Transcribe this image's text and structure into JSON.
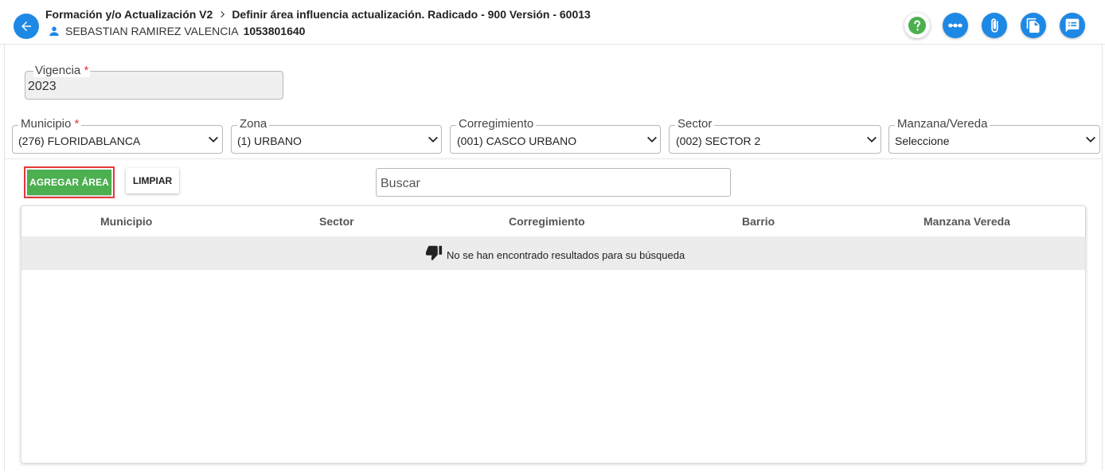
{
  "header": {
    "breadcrumb": [
      "Formación y/o Actualización V2",
      "Definir área influencia actualización. Radicado - 900 Versión - 60013"
    ],
    "user_name": "SEBASTIAN RAMIREZ VALENCIA",
    "user_id": "1053801640",
    "icons": [
      "back-arrow-icon",
      "help-icon",
      "more-icon",
      "attachment-icon",
      "documents-icon",
      "comments-icon"
    ],
    "accent_color": "#1e88e5"
  },
  "vigencia": {
    "label": "Vigencia",
    "required_mark": "*",
    "value": "2023"
  },
  "filters": [
    {
      "label": "Municipio",
      "required_mark": "*",
      "value": "(276) FLORIDABLANCA"
    },
    {
      "label": "Zona",
      "required_mark": "",
      "value": "(1) URBANO"
    },
    {
      "label": "Corregimiento",
      "required_mark": "",
      "value": "(001) CASCO URBANO"
    },
    {
      "label": "Sector",
      "required_mark": "",
      "value": "(002) SECTOR 2"
    },
    {
      "label": "Manzana/Vereda",
      "required_mark": "",
      "value": "Seleccione"
    }
  ],
  "actions": {
    "add_label": "AGREGAR ÁREA",
    "clear_label": "LIMPIAR",
    "add_color": "#4caf50"
  },
  "search": {
    "placeholder": "Buscar",
    "value": ""
  },
  "table": {
    "columns": [
      "Municipio",
      "Sector",
      "Corregimiento",
      "Barrio",
      "Manzana Vereda"
    ],
    "rows": [],
    "empty_message": "No se han encontrado resultados para su búsqueda"
  }
}
